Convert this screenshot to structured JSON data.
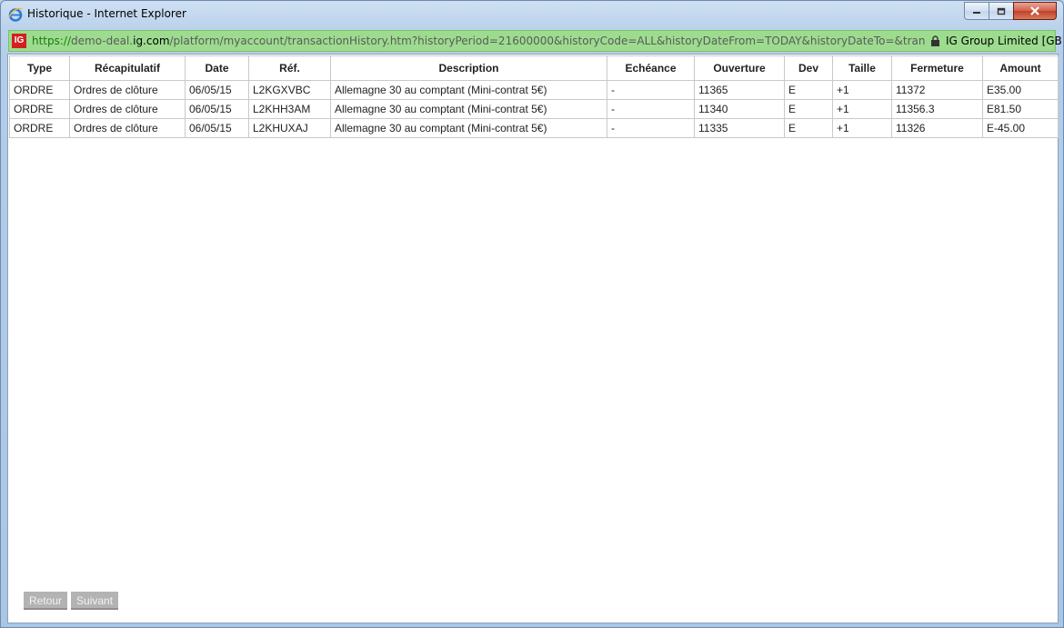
{
  "window": {
    "title": "Historique - Internet Explorer"
  },
  "address_bar": {
    "site_logo": "IG",
    "url_scheme": "https://",
    "url_subdomain": "demo-deal.",
    "url_domain": "ig.com",
    "url_path": "/platform/myaccount/transactionHistory.htm?historyPeriod=21600000&historyCode=ALL&historyDateFrom=TODAY&historyDateTo=&transactionHistoryPag",
    "identity": "IG Group Limited [GB]"
  },
  "table": {
    "headers": [
      "Type",
      "Récapitulatif",
      "Date",
      "Réf.",
      "Description",
      "Echéance",
      "Ouverture",
      "Dev",
      "Taille",
      "Fermeture",
      "Amount"
    ],
    "rows": [
      [
        "ORDRE",
        "Ordres de clôture",
        "06/05/15",
        "L2KGXVBC",
        "Allemagne 30 au comptant (Mini-contrat 5€)",
        "-",
        "11365",
        "E",
        "+1",
        "11372",
        "E35.00"
      ],
      [
        "ORDRE",
        "Ordres de clôture",
        "06/05/15",
        "L2KHH3AM",
        "Allemagne 30 au comptant (Mini-contrat 5€)",
        "-",
        "11340",
        "E",
        "+1",
        "11356.3",
        "E81.50"
      ],
      [
        "ORDRE",
        "Ordres de clôture",
        "06/05/15",
        "L2KHUXAJ",
        "Allemagne 30 au comptant (Mini-contrat 5€)",
        "-",
        "11335",
        "E",
        "+1",
        "11326",
        "E-45.00"
      ]
    ]
  },
  "pager": {
    "back_label": "Retour",
    "next_label": "Suivant"
  },
  "colors": {
    "address_bar_bg": "#9ddc8f",
    "accent_logo": "#d4201e",
    "button_disabled": "#b3b3b3"
  },
  "icons": {
    "browser": "internet-explorer-icon",
    "secure": "lock-icon"
  }
}
